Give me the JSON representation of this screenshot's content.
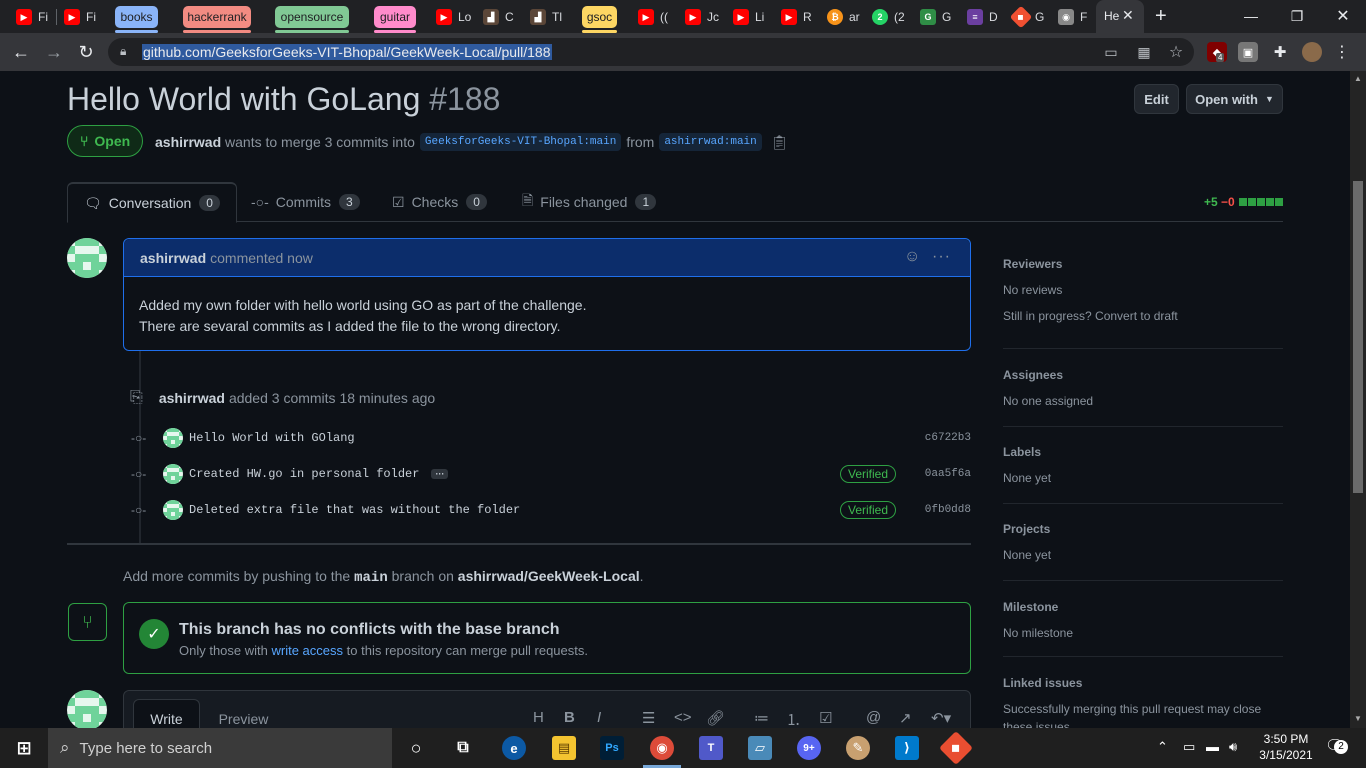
{
  "browser": {
    "tabs": [
      {
        "title": "Fi",
        "icon": "youtube-icon"
      },
      {
        "title": "Fi",
        "icon": "youtube-icon"
      },
      {
        "title": "Lo",
        "icon": "youtube-icon"
      },
      {
        "title": "C",
        "icon": "codechef-icon"
      },
      {
        "title": "Tl",
        "icon": "codechef-icon"
      },
      {
        "title": "((",
        "icon": "youtube-icon"
      },
      {
        "title": "Jc",
        "icon": "youtube-icon"
      },
      {
        "title": "Li",
        "icon": "youtube-icon"
      },
      {
        "title": "R",
        "icon": "youtube-icon"
      },
      {
        "title": "ar",
        "icon": "bitcoin-icon"
      },
      {
        "title": "(2",
        "icon": "whatsapp-icon"
      },
      {
        "title": "G",
        "icon": "gfg-icon"
      },
      {
        "title": "D",
        "icon": "docs-icon"
      },
      {
        "title": "G",
        "icon": "git-icon"
      },
      {
        "title": "F",
        "icon": "page-icon"
      },
      {
        "title": "He",
        "icon": "github-icon"
      }
    ],
    "groups": [
      {
        "label": "books",
        "color": "#8ab4f8"
      },
      {
        "label": "hackerrank",
        "color": "#f28b82"
      },
      {
        "label": "opensource",
        "color": "#81c995"
      },
      {
        "label": "guitar",
        "color": "#ff8bcb"
      },
      {
        "label": "gsoc",
        "color": "#fdd663"
      }
    ],
    "url": "github.com/GeeksforGeeks-VIT-Bhopal/GeekWeek-Local/pull/188",
    "ext_badge": "4"
  },
  "pr": {
    "title": "Hello World with GoLang",
    "number": "#188",
    "edit_label": "Edit",
    "open_with_label": "Open with",
    "state": "Open",
    "author": "ashirrwad",
    "merge_text": "wants to merge 3 commits into",
    "base_branch": "GeeksforGeeks-VIT-Bhopal:main",
    "from_text": "from",
    "head_branch": "ashirrwad:main"
  },
  "tabs": [
    {
      "label": "Conversation",
      "count": "0"
    },
    {
      "label": "Commits",
      "count": "3"
    },
    {
      "label": "Checks",
      "count": "0"
    },
    {
      "label": "Files changed",
      "count": "1"
    }
  ],
  "diffstat": {
    "added": "+5",
    "removed": "−0"
  },
  "comment": {
    "author": "ashirrwad",
    "action": "commented now",
    "line1": "Added my own folder with hello world using GO as part of the challenge.",
    "line2": "There are sevaral commits as I added the file to the wrong directory."
  },
  "push_event": {
    "author": "ashirrwad",
    "text": "added 3 commits",
    "time": "18 minutes ago"
  },
  "commits": [
    {
      "message": "Hello World with GOlang",
      "sha": "c6722b3",
      "verified": ""
    },
    {
      "message": "Created HW.go in personal folder",
      "sha": "0aa5f6a",
      "verified": "Verified"
    },
    {
      "message": "Deleted extra file that was without the folder",
      "sha": "0fb0dd8",
      "verified": "Verified"
    }
  ],
  "hint": {
    "pre": "Add more commits by pushing to the",
    "branch": "main",
    "mid": "branch on",
    "repo": "ashirrwad/GeekWeek-Local",
    "end": "."
  },
  "merge": {
    "title": "This branch has no conflicts with the base branch",
    "sub_pre": "Only those with",
    "sub_link": "write access",
    "sub_post": "to this repository can merge pull requests."
  },
  "editor": {
    "write": "Write",
    "preview": "Preview"
  },
  "sidebar": {
    "reviewers": {
      "title": "Reviewers",
      "value": "No reviews",
      "extra": "Still in progress? Convert to draft"
    },
    "assignees": {
      "title": "Assignees",
      "value": "No one assigned"
    },
    "labels": {
      "title": "Labels",
      "value": "None yet"
    },
    "projects": {
      "title": "Projects",
      "value": "None yet"
    },
    "milestone": {
      "title": "Milestone",
      "value": "No milestone"
    },
    "linked": {
      "title": "Linked issues",
      "value": "Successfully merging this pull request may close",
      "value2": "these issues."
    }
  },
  "taskbar": {
    "search_placeholder": "Type here to search",
    "time": "3:50 PM",
    "date": "3/15/2021",
    "notifications": "2"
  }
}
